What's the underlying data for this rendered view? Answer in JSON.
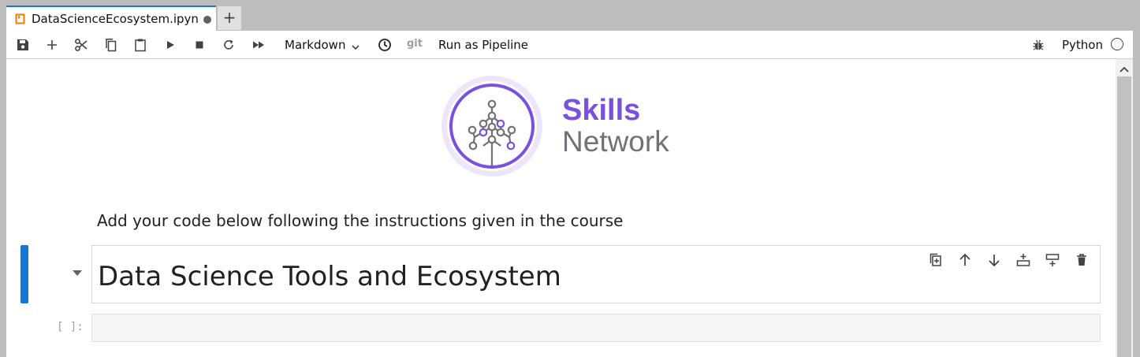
{
  "tab": {
    "title": "DataScienceEcosystem.ipyn",
    "add_label": "+"
  },
  "toolbar": {
    "cell_type": "Markdown",
    "git_label": "git",
    "pipeline_label": "Run as Pipeline",
    "kernel_name": "Python",
    "icons": [
      "save-icon",
      "add-cell-icon",
      "cut-icon",
      "copy-icon",
      "paste-icon",
      "run-icon",
      "stop-icon",
      "restart-icon",
      "fast-forward-icon",
      "clock-icon",
      "bug-icon"
    ]
  },
  "logo": {
    "line1": "Skills",
    "line2": "Network"
  },
  "markdown_cell": {
    "text": "Add your code below following the instructions given in the course"
  },
  "heading_cell": {
    "text": "Data Science Tools and Ecosystem",
    "tools": [
      "duplicate-cell-icon",
      "move-up-icon",
      "move-down-icon",
      "insert-above-icon",
      "insert-below-icon",
      "delete-cell-icon"
    ]
  },
  "code_cell": {
    "prompt": "[ ]:"
  },
  "colors": {
    "accent": "#1976d2",
    "logo_purple": "#7b4fe0",
    "logo_gray": "#6f7378"
  }
}
